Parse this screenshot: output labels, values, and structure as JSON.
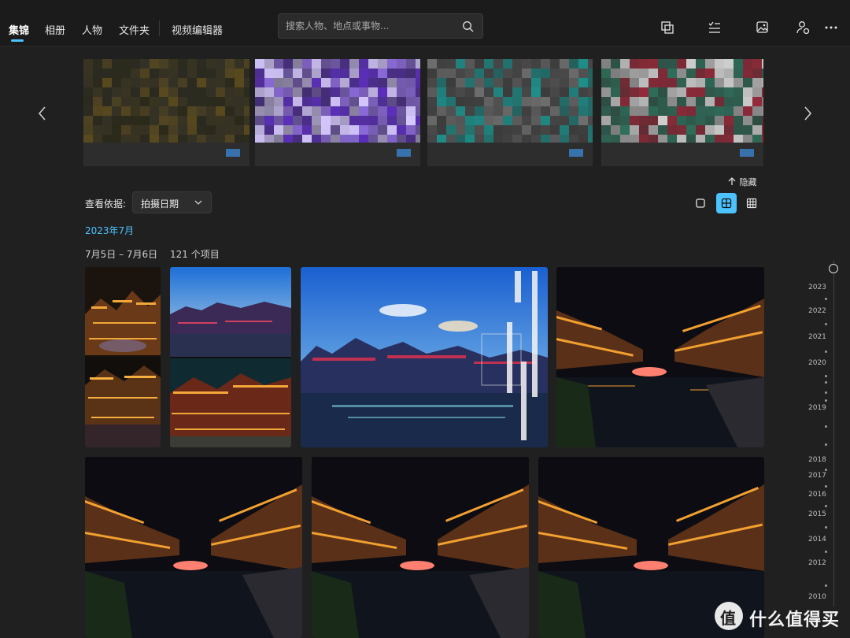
{
  "nav": {
    "tabs": [
      {
        "label": "集锦",
        "active": true
      },
      {
        "label": "相册"
      },
      {
        "label": "人物"
      },
      {
        "label": "文件夹"
      },
      {
        "label": "视频编辑器"
      }
    ]
  },
  "search": {
    "placeholder": "搜索人物、地点或事物..."
  },
  "toolbar_icons": [
    "duplicate-icon",
    "select-checklist-icon",
    "import-image-icon",
    "account-icon",
    "more-icon"
  ],
  "carousel": {
    "cards": [
      {
        "caption": "",
        "colors": [
          "#3a3520",
          "#5a4a1e",
          "#2b2a1a"
        ]
      },
      {
        "caption": "",
        "colors": [
          "#5b2fb8",
          "#8b6ad8",
          "#d6c8ff"
        ]
      },
      {
        "caption": "",
        "colors": [
          "#4a4a4a",
          "#1f8f8a",
          "#6e6e6e"
        ]
      },
      {
        "caption": "",
        "colors": [
          "#2f6e5a",
          "#9a2a3a",
          "#cfcfcf"
        ]
      }
    ],
    "hide_label": "隐藏"
  },
  "filter": {
    "label": "查看依据:",
    "selected": "拍摄日期",
    "view_modes": [
      "single-view-icon",
      "medium-grid-icon",
      "small-grid-icon"
    ],
    "active_view": 1
  },
  "gallery": {
    "month_label": "2023年7月",
    "date_range": "7月5日 – 7月6日",
    "item_count": "121 个项目"
  },
  "timeline": {
    "years": [
      "2023",
      "2022",
      "2021",
      "2020",
      "2019",
      "2018",
      "2017",
      "2016",
      "2015",
      "2014",
      "2012",
      "2010"
    ]
  },
  "watermark": {
    "text": "什么值得买",
    "badge": "值"
  },
  "colors": {
    "accent": "#4cc2ff",
    "background": "#202020",
    "sky": "#2a78d6",
    "night": "#0d0d14",
    "lights": "#f0a030"
  }
}
